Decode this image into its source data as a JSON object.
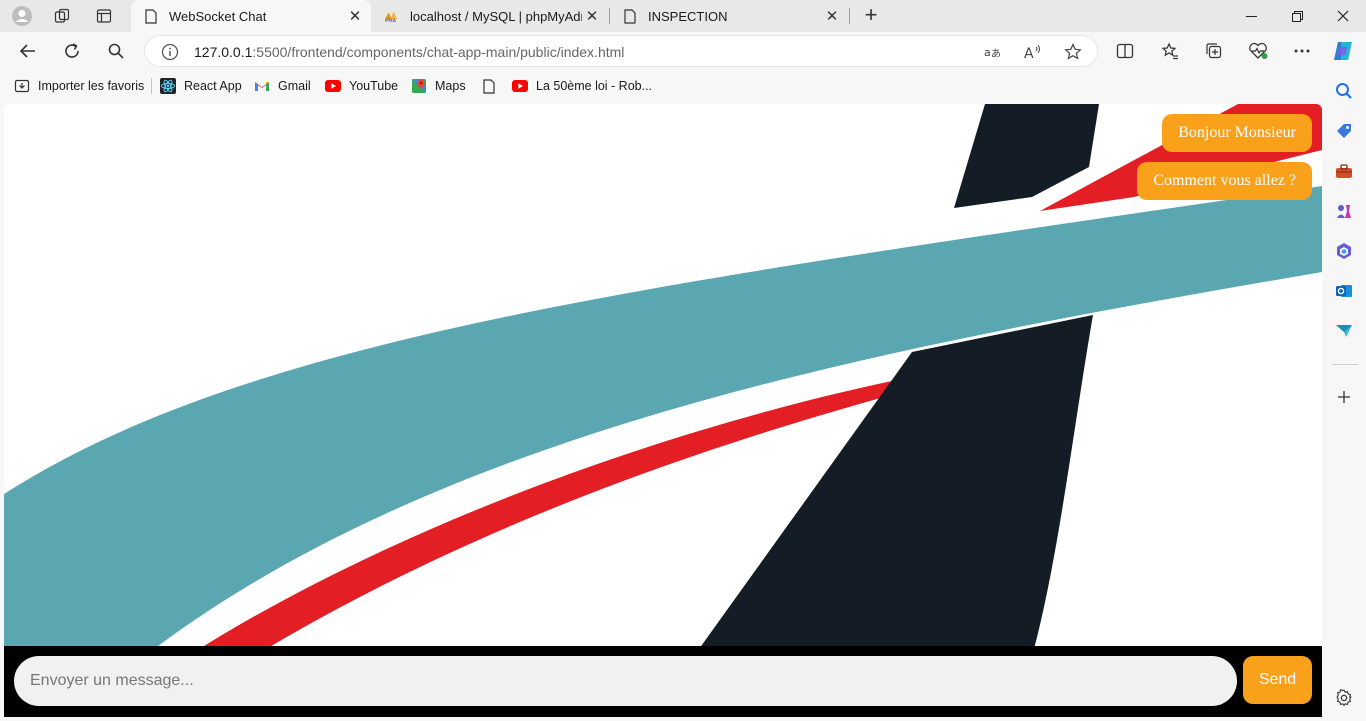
{
  "tabs": [
    {
      "title": "WebSocket Chat",
      "active": true,
      "icon": "page-icon"
    },
    {
      "title": "localhost / MySQL | phpMyAdmin",
      "active": false,
      "icon": "phpmyadmin-icon"
    },
    {
      "title": "INSPECTION",
      "active": false,
      "icon": "page-icon"
    }
  ],
  "address": {
    "host": "127.0.0.1",
    "rest": ":5500/frontend/components/chat-app-main/public/index.html"
  },
  "bookmarks": {
    "import": "Importer les favoris",
    "react": "React App",
    "gmail": "Gmail",
    "youtube": "YouTube",
    "maps": "Maps",
    "loi": "La 50ème loi - Rob..."
  },
  "chat": {
    "messages": [
      "Bonjour Monsieur",
      "Comment vous allez ?"
    ],
    "input_placeholder": "Envoyer un message...",
    "send_label": "Send"
  },
  "colors": {
    "accent": "#f9a11b",
    "teal": "#5aa7b1",
    "red": "#e31e24",
    "navy": "#141c26"
  }
}
